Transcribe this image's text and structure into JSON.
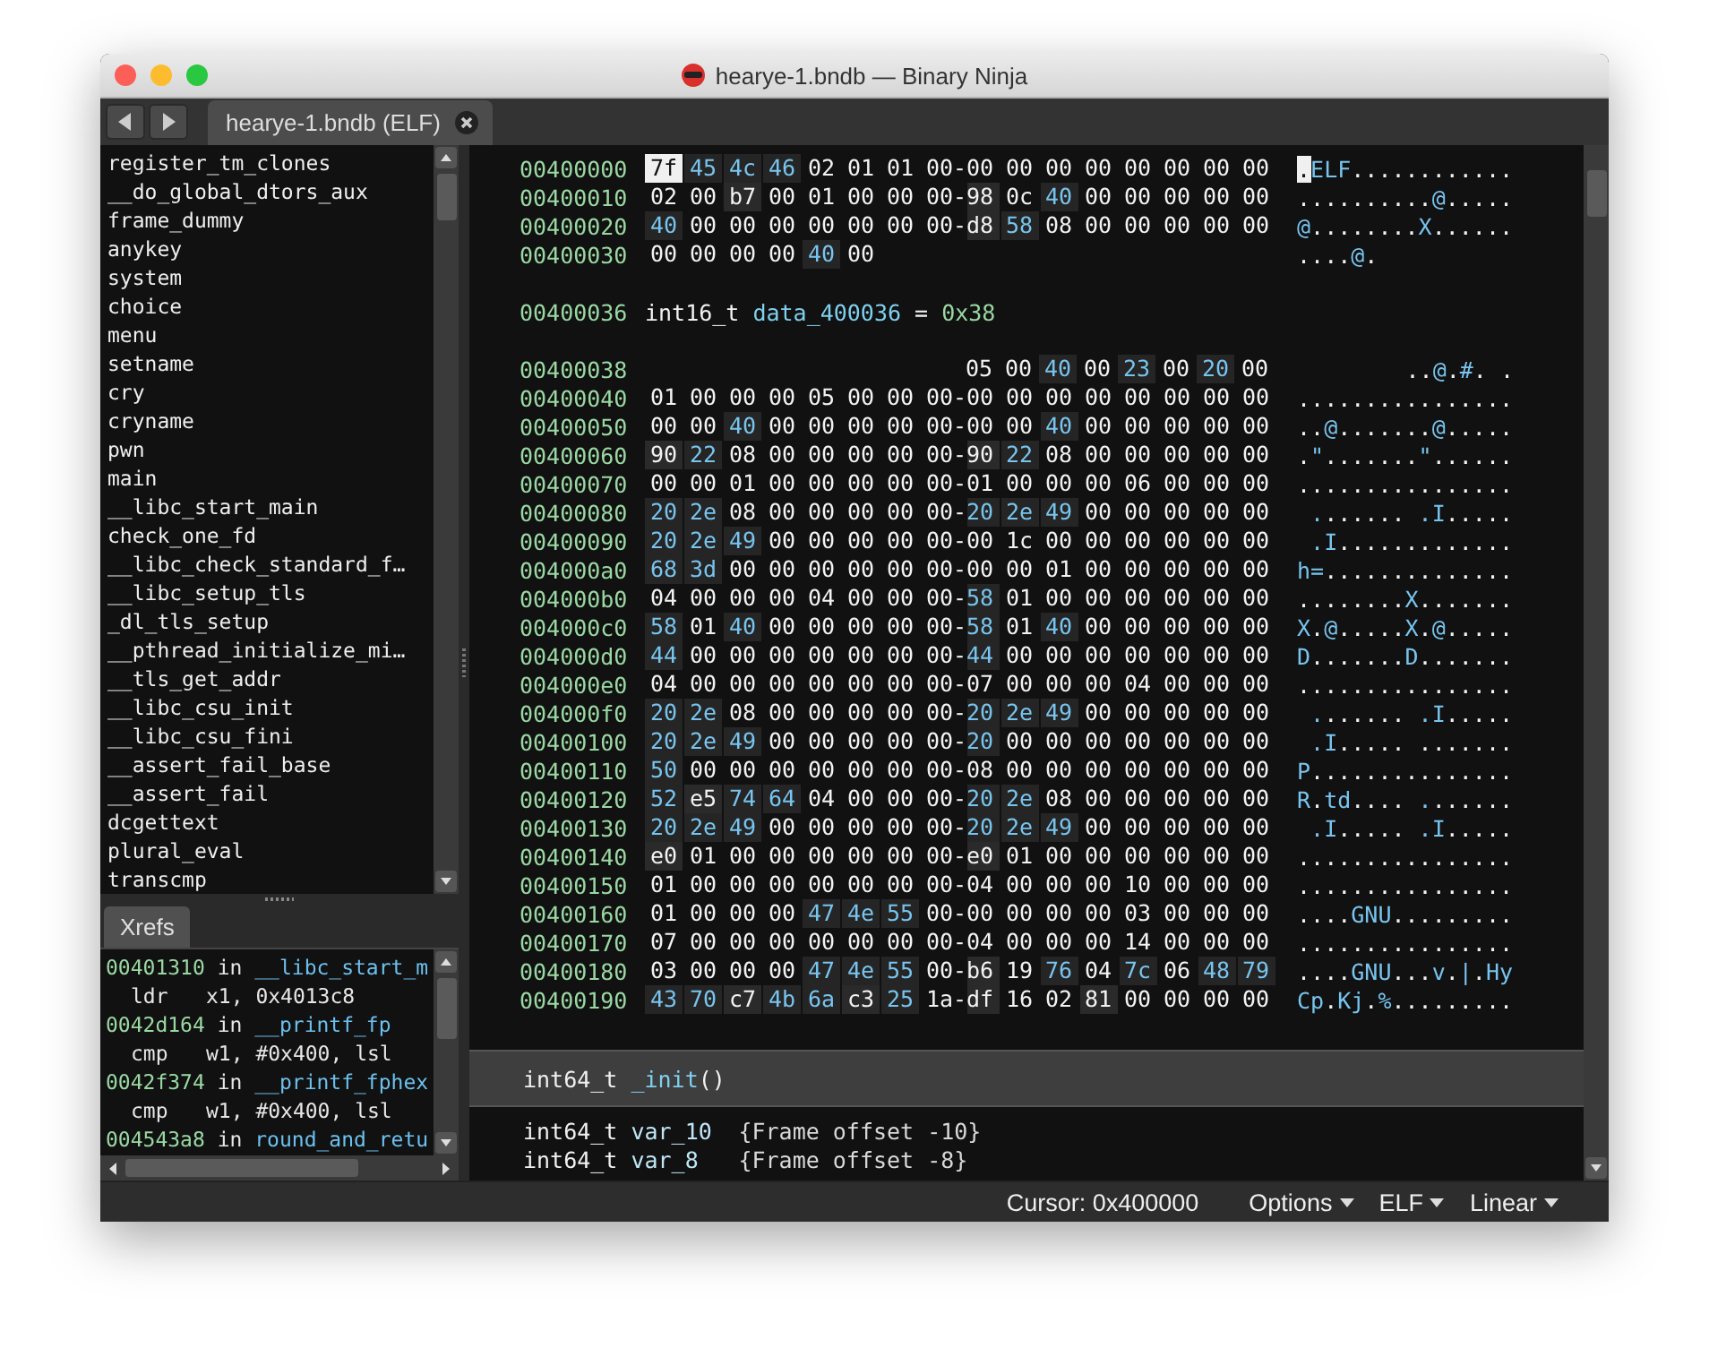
{
  "window": {
    "title": "hearye-1.bndb — Binary Ninja"
  },
  "tabs": [
    {
      "label": "hearye-1.bndb (ELF)",
      "selected": true
    }
  ],
  "symbols": [
    "register_tm_clones",
    "__do_global_dtors_aux",
    "frame_dummy",
    "anykey",
    "system",
    "choice",
    "menu",
    "setname",
    "cry",
    "cryname",
    "pwn",
    "main",
    "__libc_start_main",
    "check_one_fd",
    "__libc_check_standard_f…",
    "__libc_setup_tls",
    "_dl_tls_setup",
    "__pthread_initialize_mi…",
    "__tls_get_addr",
    "__libc_csu_init",
    "__libc_csu_fini",
    "__assert_fail_base",
    "__assert_fail",
    "dcgettext",
    "plural_eval",
    "transcmp"
  ],
  "xrefs_panel": {
    "tabs": [
      {
        "label": "Xrefs",
        "selected": true
      }
    ],
    "entries": [
      {
        "address": "00401310",
        "in": "in",
        "function": "__libc_start_m",
        "mnemonic": "ldr",
        "operands": "x1, 0x4013c8"
      },
      {
        "address": "0042d164",
        "in": "in",
        "function": "__printf_fp",
        "mnemonic": "cmp",
        "operands": "w1, #0x400, lsl"
      },
      {
        "address": "0042f374",
        "in": "in",
        "function": "__printf_fphex",
        "mnemonic": "cmp",
        "operands": "w1, #0x400, lsl"
      },
      {
        "address": "004543a8",
        "in": "in",
        "function": "round_and_retu"
      }
    ]
  },
  "hex": {
    "separator": "-",
    "rows": [
      {
        "kind": "bytes",
        "address": "00400000",
        "ascii": ".ELF............",
        "bytes": [
          {
            "value": "7f",
            "kind": "cursor"
          },
          {
            "value": "45",
            "kind": "printable"
          },
          {
            "value": "4c",
            "kind": "printable"
          },
          {
            "value": "46",
            "kind": "printable"
          },
          {
            "value": "02",
            "kind": "plain"
          },
          {
            "value": "01",
            "kind": "plain"
          },
          {
            "value": "01",
            "kind": "plain"
          },
          {
            "value": "00",
            "kind": "plain"
          },
          {
            "value": "00",
            "kind": "plain"
          },
          {
            "value": "00",
            "kind": "plain"
          },
          {
            "value": "00",
            "kind": "plain"
          },
          {
            "value": "00",
            "kind": "plain"
          },
          {
            "value": "00",
            "kind": "plain"
          },
          {
            "value": "00",
            "kind": "plain"
          },
          {
            "value": "00",
            "kind": "plain"
          },
          {
            "value": "00",
            "kind": "plain"
          }
        ]
      },
      {
        "kind": "bytes",
        "address": "00400010",
        "ascii": "..........@.....",
        "bytes": [
          {
            "value": "02",
            "kind": "plain"
          },
          {
            "value": "00",
            "kind": "plain"
          },
          {
            "value": "b7",
            "kind": "high"
          },
          {
            "value": "00",
            "kind": "plain"
          },
          {
            "value": "01",
            "kind": "plain"
          },
          {
            "value": "00",
            "kind": "plain"
          },
          {
            "value": "00",
            "kind": "plain"
          },
          {
            "value": "00",
            "kind": "plain"
          },
          {
            "value": "98",
            "kind": "high"
          },
          {
            "value": "0c",
            "kind": "plain"
          },
          {
            "value": "40",
            "kind": "printable"
          },
          {
            "value": "00",
            "kind": "plain"
          },
          {
            "value": "00",
            "kind": "plain"
          },
          {
            "value": "00",
            "kind": "plain"
          },
          {
            "value": "00",
            "kind": "plain"
          },
          {
            "value": "00",
            "kind": "plain"
          }
        ]
      },
      {
        "kind": "bytes",
        "address": "00400020",
        "ascii": "@........X......",
        "bytes": [
          {
            "value": "40",
            "kind": "printable"
          },
          {
            "value": "00",
            "kind": "plain"
          },
          {
            "value": "00",
            "kind": "plain"
          },
          {
            "value": "00",
            "kind": "plain"
          },
          {
            "value": "00",
            "kind": "plain"
          },
          {
            "value": "00",
            "kind": "plain"
          },
          {
            "value": "00",
            "kind": "plain"
          },
          {
            "value": "00",
            "kind": "plain"
          },
          {
            "value": "d8",
            "kind": "high"
          },
          {
            "value": "58",
            "kind": "printable"
          },
          {
            "value": "08",
            "kind": "plain"
          },
          {
            "value": "00",
            "kind": "plain"
          },
          {
            "value": "00",
            "kind": "plain"
          },
          {
            "value": "00",
            "kind": "plain"
          },
          {
            "value": "00",
            "kind": "plain"
          },
          {
            "value": "00",
            "kind": "plain"
          }
        ]
      },
      {
        "kind": "bytes",
        "address": "00400030",
        "ascii": "....@.",
        "bytes": [
          {
            "value": "00",
            "kind": "plain"
          },
          {
            "value": "00",
            "kind": "plain"
          },
          {
            "value": "00",
            "kind": "plain"
          },
          {
            "value": "00",
            "kind": "plain"
          },
          {
            "value": "40",
            "kind": "printable"
          },
          {
            "value": "00",
            "kind": "plain"
          }
        ]
      },
      {
        "kind": "type",
        "address": "00400036",
        "type": "int16_t",
        "name": "data_400036",
        "operator": "=",
        "value": "0x38"
      },
      {
        "kind": "tail",
        "address": "00400038",
        "ascii": "..@.#. .",
        "bytes": [
          {
            "value": "05",
            "kind": "plain"
          },
          {
            "value": "00",
            "kind": "plain"
          },
          {
            "value": "40",
            "kind": "printable"
          },
          {
            "value": "00",
            "kind": "plain"
          },
          {
            "value": "23",
            "kind": "printable"
          },
          {
            "value": "00",
            "kind": "plain"
          },
          {
            "value": "20",
            "kind": "printable"
          },
          {
            "value": "00",
            "kind": "plain"
          }
        ]
      },
      {
        "kind": "bytes",
        "address": "00400040",
        "ascii": "................",
        "bytes": [
          {
            "value": "01",
            "kind": "plain"
          },
          {
            "value": "00",
            "kind": "plain"
          },
          {
            "value": "00",
            "kind": "plain"
          },
          {
            "value": "00",
            "kind": "plain"
          },
          {
            "value": "05",
            "kind": "plain"
          },
          {
            "value": "00",
            "kind": "plain"
          },
          {
            "value": "00",
            "kind": "plain"
          },
          {
            "value": "00",
            "kind": "plain"
          },
          {
            "value": "00",
            "kind": "plain"
          },
          {
            "value": "00",
            "kind": "plain"
          },
          {
            "value": "00",
            "kind": "plain"
          },
          {
            "value": "00",
            "kind": "plain"
          },
          {
            "value": "00",
            "kind": "plain"
          },
          {
            "value": "00",
            "kind": "plain"
          },
          {
            "value": "00",
            "kind": "plain"
          },
          {
            "value": "00",
            "kind": "plain"
          }
        ]
      },
      {
        "kind": "bytes",
        "address": "00400050",
        "ascii": "..@.......@.....",
        "bytes": [
          {
            "value": "00",
            "kind": "plain"
          },
          {
            "value": "00",
            "kind": "plain"
          },
          {
            "value": "40",
            "kind": "printable"
          },
          {
            "value": "00",
            "kind": "plain"
          },
          {
            "value": "00",
            "kind": "plain"
          },
          {
            "value": "00",
            "kind": "plain"
          },
          {
            "value": "00",
            "kind": "plain"
          },
          {
            "value": "00",
            "kind": "plain"
          },
          {
            "value": "00",
            "kind": "plain"
          },
          {
            "value": "00",
            "kind": "plain"
          },
          {
            "value": "40",
            "kind": "printable"
          },
          {
            "value": "00",
            "kind": "plain"
          },
          {
            "value": "00",
            "kind": "plain"
          },
          {
            "value": "00",
            "kind": "plain"
          },
          {
            "value": "00",
            "kind": "plain"
          },
          {
            "value": "00",
            "kind": "plain"
          }
        ]
      },
      {
        "kind": "bytes",
        "address": "00400060",
        "ascii": ".\".......\"......",
        "bytes": [
          {
            "value": "90",
            "kind": "high"
          },
          {
            "value": "22",
            "kind": "printable"
          },
          {
            "value": "08",
            "kind": "plain"
          },
          {
            "value": "00",
            "kind": "plain"
          },
          {
            "value": "00",
            "kind": "plain"
          },
          {
            "value": "00",
            "kind": "plain"
          },
          {
            "value": "00",
            "kind": "plain"
          },
          {
            "value": "00",
            "kind": "plain"
          },
          {
            "value": "90",
            "kind": "high"
          },
          {
            "value": "22",
            "kind": "printable"
          },
          {
            "value": "08",
            "kind": "plain"
          },
          {
            "value": "00",
            "kind": "plain"
          },
          {
            "value": "00",
            "kind": "plain"
          },
          {
            "value": "00",
            "kind": "plain"
          },
          {
            "value": "00",
            "kind": "plain"
          },
          {
            "value": "00",
            "kind": "plain"
          }
        ]
      },
      {
        "kind": "bytes",
        "address": "00400070",
        "ascii": "................",
        "bytes": [
          {
            "value": "00",
            "kind": "plain"
          },
          {
            "value": "00",
            "kind": "plain"
          },
          {
            "value": "01",
            "kind": "plain"
          },
          {
            "value": "00",
            "kind": "plain"
          },
          {
            "value": "00",
            "kind": "plain"
          },
          {
            "value": "00",
            "kind": "plain"
          },
          {
            "value": "00",
            "kind": "plain"
          },
          {
            "value": "00",
            "kind": "plain"
          },
          {
            "value": "01",
            "kind": "plain"
          },
          {
            "value": "00",
            "kind": "plain"
          },
          {
            "value": "00",
            "kind": "plain"
          },
          {
            "value": "00",
            "kind": "plain"
          },
          {
            "value": "06",
            "kind": "plain"
          },
          {
            "value": "00",
            "kind": "plain"
          },
          {
            "value": "00",
            "kind": "plain"
          },
          {
            "value": "00",
            "kind": "plain"
          }
        ]
      },
      {
        "kind": "bytes",
        "address": "00400080",
        "ascii": " ....... .I.....",
        "bytes": [
          {
            "value": "20",
            "kind": "printable"
          },
          {
            "value": "2e",
            "kind": "printable"
          },
          {
            "value": "08",
            "kind": "plain"
          },
          {
            "value": "00",
            "kind": "plain"
          },
          {
            "value": "00",
            "kind": "plain"
          },
          {
            "value": "00",
            "kind": "plain"
          },
          {
            "value": "00",
            "kind": "plain"
          },
          {
            "value": "00",
            "kind": "plain"
          },
          {
            "value": "20",
            "kind": "printable"
          },
          {
            "value": "2e",
            "kind": "printable"
          },
          {
            "value": "49",
            "kind": "printable"
          },
          {
            "value": "00",
            "kind": "plain"
          },
          {
            "value": "00",
            "kind": "plain"
          },
          {
            "value": "00",
            "kind": "plain"
          },
          {
            "value": "00",
            "kind": "plain"
          },
          {
            "value": "00",
            "kind": "plain"
          }
        ]
      },
      {
        "kind": "bytes",
        "address": "00400090",
        "ascii": " .I.............",
        "bytes": [
          {
            "value": "20",
            "kind": "printable"
          },
          {
            "value": "2e",
            "kind": "printable"
          },
          {
            "value": "49",
            "kind": "printable"
          },
          {
            "value": "00",
            "kind": "plain"
          },
          {
            "value": "00",
            "kind": "plain"
          },
          {
            "value": "00",
            "kind": "plain"
          },
          {
            "value": "00",
            "kind": "plain"
          },
          {
            "value": "00",
            "kind": "plain"
          },
          {
            "value": "00",
            "kind": "plain"
          },
          {
            "value": "1c",
            "kind": "plain"
          },
          {
            "value": "00",
            "kind": "plain"
          },
          {
            "value": "00",
            "kind": "plain"
          },
          {
            "value": "00",
            "kind": "plain"
          },
          {
            "value": "00",
            "kind": "plain"
          },
          {
            "value": "00",
            "kind": "plain"
          },
          {
            "value": "00",
            "kind": "plain"
          }
        ]
      },
      {
        "kind": "bytes",
        "address": "004000a0",
        "ascii": "h=..............",
        "bytes": [
          {
            "value": "68",
            "kind": "printable"
          },
          {
            "value": "3d",
            "kind": "printable"
          },
          {
            "value": "00",
            "kind": "plain"
          },
          {
            "value": "00",
            "kind": "plain"
          },
          {
            "value": "00",
            "kind": "plain"
          },
          {
            "value": "00",
            "kind": "plain"
          },
          {
            "value": "00",
            "kind": "plain"
          },
          {
            "value": "00",
            "kind": "plain"
          },
          {
            "value": "00",
            "kind": "plain"
          },
          {
            "value": "00",
            "kind": "plain"
          },
          {
            "value": "01",
            "kind": "plain"
          },
          {
            "value": "00",
            "kind": "plain"
          },
          {
            "value": "00",
            "kind": "plain"
          },
          {
            "value": "00",
            "kind": "plain"
          },
          {
            "value": "00",
            "kind": "plain"
          },
          {
            "value": "00",
            "kind": "plain"
          }
        ]
      },
      {
        "kind": "bytes",
        "address": "004000b0",
        "ascii": "........X.......",
        "bytes": [
          {
            "value": "04",
            "kind": "plain"
          },
          {
            "value": "00",
            "kind": "plain"
          },
          {
            "value": "00",
            "kind": "plain"
          },
          {
            "value": "00",
            "kind": "plain"
          },
          {
            "value": "04",
            "kind": "plain"
          },
          {
            "value": "00",
            "kind": "plain"
          },
          {
            "value": "00",
            "kind": "plain"
          },
          {
            "value": "00",
            "kind": "plain"
          },
          {
            "value": "58",
            "kind": "printable"
          },
          {
            "value": "01",
            "kind": "plain"
          },
          {
            "value": "00",
            "kind": "plain"
          },
          {
            "value": "00",
            "kind": "plain"
          },
          {
            "value": "00",
            "kind": "plain"
          },
          {
            "value": "00",
            "kind": "plain"
          },
          {
            "value": "00",
            "kind": "plain"
          },
          {
            "value": "00",
            "kind": "plain"
          }
        ]
      },
      {
        "kind": "bytes",
        "address": "004000c0",
        "ascii": "X.@.....X.@.....",
        "bytes": [
          {
            "value": "58",
            "kind": "printable"
          },
          {
            "value": "01",
            "kind": "plain"
          },
          {
            "value": "40",
            "kind": "printable"
          },
          {
            "value": "00",
            "kind": "plain"
          },
          {
            "value": "00",
            "kind": "plain"
          },
          {
            "value": "00",
            "kind": "plain"
          },
          {
            "value": "00",
            "kind": "plain"
          },
          {
            "value": "00",
            "kind": "plain"
          },
          {
            "value": "58",
            "kind": "printable"
          },
          {
            "value": "01",
            "kind": "plain"
          },
          {
            "value": "40",
            "kind": "printable"
          },
          {
            "value": "00",
            "kind": "plain"
          },
          {
            "value": "00",
            "kind": "plain"
          },
          {
            "value": "00",
            "kind": "plain"
          },
          {
            "value": "00",
            "kind": "plain"
          },
          {
            "value": "00",
            "kind": "plain"
          }
        ]
      },
      {
        "kind": "bytes",
        "address": "004000d0",
        "ascii": "D.......D.......",
        "bytes": [
          {
            "value": "44",
            "kind": "printable"
          },
          {
            "value": "00",
            "kind": "plain"
          },
          {
            "value": "00",
            "kind": "plain"
          },
          {
            "value": "00",
            "kind": "plain"
          },
          {
            "value": "00",
            "kind": "plain"
          },
          {
            "value": "00",
            "kind": "plain"
          },
          {
            "value": "00",
            "kind": "plain"
          },
          {
            "value": "00",
            "kind": "plain"
          },
          {
            "value": "44",
            "kind": "printable"
          },
          {
            "value": "00",
            "kind": "plain"
          },
          {
            "value": "00",
            "kind": "plain"
          },
          {
            "value": "00",
            "kind": "plain"
          },
          {
            "value": "00",
            "kind": "plain"
          },
          {
            "value": "00",
            "kind": "plain"
          },
          {
            "value": "00",
            "kind": "plain"
          },
          {
            "value": "00",
            "kind": "plain"
          }
        ]
      },
      {
        "kind": "bytes",
        "address": "004000e0",
        "ascii": "................",
        "bytes": [
          {
            "value": "04",
            "kind": "plain"
          },
          {
            "value": "00",
            "kind": "plain"
          },
          {
            "value": "00",
            "kind": "plain"
          },
          {
            "value": "00",
            "kind": "plain"
          },
          {
            "value": "00",
            "kind": "plain"
          },
          {
            "value": "00",
            "kind": "plain"
          },
          {
            "value": "00",
            "kind": "plain"
          },
          {
            "value": "00",
            "kind": "plain"
          },
          {
            "value": "07",
            "kind": "plain"
          },
          {
            "value": "00",
            "kind": "plain"
          },
          {
            "value": "00",
            "kind": "plain"
          },
          {
            "value": "00",
            "kind": "plain"
          },
          {
            "value": "04",
            "kind": "plain"
          },
          {
            "value": "00",
            "kind": "plain"
          },
          {
            "value": "00",
            "kind": "plain"
          },
          {
            "value": "00",
            "kind": "plain"
          }
        ]
      },
      {
        "kind": "bytes",
        "address": "004000f0",
        "ascii": " ....... .I.....",
        "bytes": [
          {
            "value": "20",
            "kind": "printable"
          },
          {
            "value": "2e",
            "kind": "printable"
          },
          {
            "value": "08",
            "kind": "plain"
          },
          {
            "value": "00",
            "kind": "plain"
          },
          {
            "value": "00",
            "kind": "plain"
          },
          {
            "value": "00",
            "kind": "plain"
          },
          {
            "value": "00",
            "kind": "plain"
          },
          {
            "value": "00",
            "kind": "plain"
          },
          {
            "value": "20",
            "kind": "printable"
          },
          {
            "value": "2e",
            "kind": "printable"
          },
          {
            "value": "49",
            "kind": "printable"
          },
          {
            "value": "00",
            "kind": "plain"
          },
          {
            "value": "00",
            "kind": "plain"
          },
          {
            "value": "00",
            "kind": "plain"
          },
          {
            "value": "00",
            "kind": "plain"
          },
          {
            "value": "00",
            "kind": "plain"
          }
        ]
      },
      {
        "kind": "bytes",
        "address": "00400100",
        "ascii": " .I..... .......",
        "bytes": [
          {
            "value": "20",
            "kind": "printable"
          },
          {
            "value": "2e",
            "kind": "printable"
          },
          {
            "value": "49",
            "kind": "printable"
          },
          {
            "value": "00",
            "kind": "plain"
          },
          {
            "value": "00",
            "kind": "plain"
          },
          {
            "value": "00",
            "kind": "plain"
          },
          {
            "value": "00",
            "kind": "plain"
          },
          {
            "value": "00",
            "kind": "plain"
          },
          {
            "value": "20",
            "kind": "printable"
          },
          {
            "value": "00",
            "kind": "plain"
          },
          {
            "value": "00",
            "kind": "plain"
          },
          {
            "value": "00",
            "kind": "plain"
          },
          {
            "value": "00",
            "kind": "plain"
          },
          {
            "value": "00",
            "kind": "plain"
          },
          {
            "value": "00",
            "kind": "plain"
          },
          {
            "value": "00",
            "kind": "plain"
          }
        ]
      },
      {
        "kind": "bytes",
        "address": "00400110",
        "ascii": "P...............",
        "bytes": [
          {
            "value": "50",
            "kind": "printable"
          },
          {
            "value": "00",
            "kind": "plain"
          },
          {
            "value": "00",
            "kind": "plain"
          },
          {
            "value": "00",
            "kind": "plain"
          },
          {
            "value": "00",
            "kind": "plain"
          },
          {
            "value": "00",
            "kind": "plain"
          },
          {
            "value": "00",
            "kind": "plain"
          },
          {
            "value": "00",
            "kind": "plain"
          },
          {
            "value": "08",
            "kind": "plain"
          },
          {
            "value": "00",
            "kind": "plain"
          },
          {
            "value": "00",
            "kind": "plain"
          },
          {
            "value": "00",
            "kind": "plain"
          },
          {
            "value": "00",
            "kind": "plain"
          },
          {
            "value": "00",
            "kind": "plain"
          },
          {
            "value": "00",
            "kind": "plain"
          },
          {
            "value": "00",
            "kind": "plain"
          }
        ]
      },
      {
        "kind": "bytes",
        "address": "00400120",
        "ascii": "R.td.... .......",
        "bytes": [
          {
            "value": "52",
            "kind": "printable"
          },
          {
            "value": "e5",
            "kind": "high"
          },
          {
            "value": "74",
            "kind": "printable"
          },
          {
            "value": "64",
            "kind": "printable"
          },
          {
            "value": "04",
            "kind": "plain"
          },
          {
            "value": "00",
            "kind": "plain"
          },
          {
            "value": "00",
            "kind": "plain"
          },
          {
            "value": "00",
            "kind": "plain"
          },
          {
            "value": "20",
            "kind": "printable"
          },
          {
            "value": "2e",
            "kind": "printable"
          },
          {
            "value": "08",
            "kind": "plain"
          },
          {
            "value": "00",
            "kind": "plain"
          },
          {
            "value": "00",
            "kind": "plain"
          },
          {
            "value": "00",
            "kind": "plain"
          },
          {
            "value": "00",
            "kind": "plain"
          },
          {
            "value": "00",
            "kind": "plain"
          }
        ]
      },
      {
        "kind": "bytes",
        "address": "00400130",
        "ascii": " .I..... .I.....",
        "bytes": [
          {
            "value": "20",
            "kind": "printable"
          },
          {
            "value": "2e",
            "kind": "printable"
          },
          {
            "value": "49",
            "kind": "printable"
          },
          {
            "value": "00",
            "kind": "plain"
          },
          {
            "value": "00",
            "kind": "plain"
          },
          {
            "value": "00",
            "kind": "plain"
          },
          {
            "value": "00",
            "kind": "plain"
          },
          {
            "value": "00",
            "kind": "plain"
          },
          {
            "value": "20",
            "kind": "printable"
          },
          {
            "value": "2e",
            "kind": "printable"
          },
          {
            "value": "49",
            "kind": "printable"
          },
          {
            "value": "00",
            "kind": "plain"
          },
          {
            "value": "00",
            "kind": "plain"
          },
          {
            "value": "00",
            "kind": "plain"
          },
          {
            "value": "00",
            "kind": "plain"
          },
          {
            "value": "00",
            "kind": "plain"
          }
        ]
      },
      {
        "kind": "bytes",
        "address": "00400140",
        "ascii": "................",
        "bytes": [
          {
            "value": "e0",
            "kind": "high"
          },
          {
            "value": "01",
            "kind": "plain"
          },
          {
            "value": "00",
            "kind": "plain"
          },
          {
            "value": "00",
            "kind": "plain"
          },
          {
            "value": "00",
            "kind": "plain"
          },
          {
            "value": "00",
            "kind": "plain"
          },
          {
            "value": "00",
            "kind": "plain"
          },
          {
            "value": "00",
            "kind": "plain"
          },
          {
            "value": "e0",
            "kind": "high"
          },
          {
            "value": "01",
            "kind": "plain"
          },
          {
            "value": "00",
            "kind": "plain"
          },
          {
            "value": "00",
            "kind": "plain"
          },
          {
            "value": "00",
            "kind": "plain"
          },
          {
            "value": "00",
            "kind": "plain"
          },
          {
            "value": "00",
            "kind": "plain"
          },
          {
            "value": "00",
            "kind": "plain"
          }
        ]
      },
      {
        "kind": "bytes",
        "address": "00400150",
        "ascii": "................",
        "bytes": [
          {
            "value": "01",
            "kind": "plain"
          },
          {
            "value": "00",
            "kind": "plain"
          },
          {
            "value": "00",
            "kind": "plain"
          },
          {
            "value": "00",
            "kind": "plain"
          },
          {
            "value": "00",
            "kind": "plain"
          },
          {
            "value": "00",
            "kind": "plain"
          },
          {
            "value": "00",
            "kind": "plain"
          },
          {
            "value": "00",
            "kind": "plain"
          },
          {
            "value": "04",
            "kind": "plain"
          },
          {
            "value": "00",
            "kind": "plain"
          },
          {
            "value": "00",
            "kind": "plain"
          },
          {
            "value": "00",
            "kind": "plain"
          },
          {
            "value": "10",
            "kind": "plain"
          },
          {
            "value": "00",
            "kind": "plain"
          },
          {
            "value": "00",
            "kind": "plain"
          },
          {
            "value": "00",
            "kind": "plain"
          }
        ]
      },
      {
        "kind": "bytes",
        "address": "00400160",
        "ascii": "....GNU.........",
        "bytes": [
          {
            "value": "01",
            "kind": "plain"
          },
          {
            "value": "00",
            "kind": "plain"
          },
          {
            "value": "00",
            "kind": "plain"
          },
          {
            "value": "00",
            "kind": "plain"
          },
          {
            "value": "47",
            "kind": "printable"
          },
          {
            "value": "4e",
            "kind": "printable"
          },
          {
            "value": "55",
            "kind": "printable"
          },
          {
            "value": "00",
            "kind": "plain"
          },
          {
            "value": "00",
            "kind": "plain"
          },
          {
            "value": "00",
            "kind": "plain"
          },
          {
            "value": "00",
            "kind": "plain"
          },
          {
            "value": "00",
            "kind": "plain"
          },
          {
            "value": "03",
            "kind": "plain"
          },
          {
            "value": "00",
            "kind": "plain"
          },
          {
            "value": "00",
            "kind": "plain"
          },
          {
            "value": "00",
            "kind": "plain"
          }
        ]
      },
      {
        "kind": "bytes",
        "address": "00400170",
        "ascii": "................",
        "bytes": [
          {
            "value": "07",
            "kind": "plain"
          },
          {
            "value": "00",
            "kind": "plain"
          },
          {
            "value": "00",
            "kind": "plain"
          },
          {
            "value": "00",
            "kind": "plain"
          },
          {
            "value": "00",
            "kind": "plain"
          },
          {
            "value": "00",
            "kind": "plain"
          },
          {
            "value": "00",
            "kind": "plain"
          },
          {
            "value": "00",
            "kind": "plain"
          },
          {
            "value": "04",
            "kind": "plain"
          },
          {
            "value": "00",
            "kind": "plain"
          },
          {
            "value": "00",
            "kind": "plain"
          },
          {
            "value": "00",
            "kind": "plain"
          },
          {
            "value": "14",
            "kind": "plain"
          },
          {
            "value": "00",
            "kind": "plain"
          },
          {
            "value": "00",
            "kind": "plain"
          },
          {
            "value": "00",
            "kind": "plain"
          }
        ]
      },
      {
        "kind": "bytes",
        "address": "00400180",
        "ascii": "....GNU...v.|.Hy",
        "bytes": [
          {
            "value": "03",
            "kind": "plain"
          },
          {
            "value": "00",
            "kind": "plain"
          },
          {
            "value": "00",
            "kind": "plain"
          },
          {
            "value": "00",
            "kind": "plain"
          },
          {
            "value": "47",
            "kind": "printable"
          },
          {
            "value": "4e",
            "kind": "printable"
          },
          {
            "value": "55",
            "kind": "printable"
          },
          {
            "value": "00",
            "kind": "plain"
          },
          {
            "value": "b6",
            "kind": "high"
          },
          {
            "value": "19",
            "kind": "plain"
          },
          {
            "value": "76",
            "kind": "printable"
          },
          {
            "value": "04",
            "kind": "plain"
          },
          {
            "value": "7c",
            "kind": "printable"
          },
          {
            "value": "06",
            "kind": "plain"
          },
          {
            "value": "48",
            "kind": "printable"
          },
          {
            "value": "79",
            "kind": "printable"
          }
        ]
      },
      {
        "kind": "bytes",
        "address": "00400190",
        "ascii": "Cp.Kj.%.........",
        "bytes": [
          {
            "value": "43",
            "kind": "printable"
          },
          {
            "value": "70",
            "kind": "printable"
          },
          {
            "value": "c7",
            "kind": "high"
          },
          {
            "value": "4b",
            "kind": "printable"
          },
          {
            "value": "6a",
            "kind": "printable"
          },
          {
            "value": "c3",
            "kind": "high"
          },
          {
            "value": "25",
            "kind": "printable"
          },
          {
            "value": "1a",
            "kind": "plain"
          },
          {
            "value": "df",
            "kind": "high"
          },
          {
            "value": "16",
            "kind": "plain"
          },
          {
            "value": "02",
            "kind": "plain"
          },
          {
            "value": "81",
            "kind": "high"
          },
          {
            "value": "00",
            "kind": "plain"
          },
          {
            "value": "00",
            "kind": "plain"
          },
          {
            "value": "00",
            "kind": "plain"
          },
          {
            "value": "00",
            "kind": "plain"
          }
        ]
      }
    ]
  },
  "function": {
    "return_type": "int64_t",
    "name": "_init",
    "suffix": "()",
    "vars": [
      {
        "type": "int64_t",
        "name": "var_10",
        "comment": "{Frame offset -10}"
      },
      {
        "type": "int64_t",
        "name": "var_8",
        "comment": "{Frame offset -8}"
      }
    ]
  },
  "status_bar": {
    "cursor": "Cursor: 0x400000",
    "menus": [
      "Options",
      "ELF",
      "Linear"
    ]
  }
}
